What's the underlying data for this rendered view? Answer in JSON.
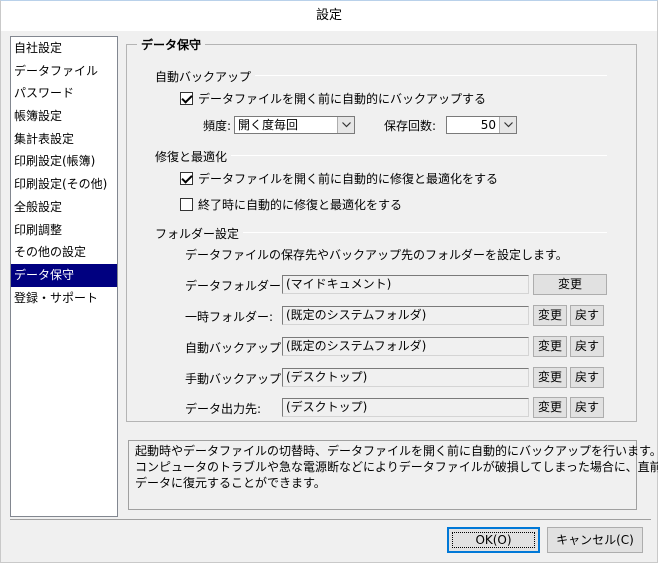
{
  "window": {
    "title": "設定"
  },
  "sidebar": {
    "items": [
      {
        "label": "自社設定"
      },
      {
        "label": "データファイル"
      },
      {
        "label": "パスワード"
      },
      {
        "label": "帳簿設定"
      },
      {
        "label": "集計表設定"
      },
      {
        "label": "印刷設定(帳簿)"
      },
      {
        "label": "印刷設定(その他)"
      },
      {
        "label": "全般設定"
      },
      {
        "label": "印刷調整"
      },
      {
        "label": "その他の設定"
      },
      {
        "label": "データ保守"
      },
      {
        "label": "登録・サポート"
      }
    ],
    "selected_index": 10
  },
  "panel": {
    "title": "データ保守",
    "auto_backup": {
      "section_title": "自動バックアップ",
      "checkbox_label": "データファイルを開く前に自動的にバックアップする",
      "checkbox_checked": true,
      "frequency_label": "頻度:",
      "frequency_value": "開く度毎回",
      "count_label": "保存回数:",
      "count_value": "50"
    },
    "repair": {
      "section_title": "修復と最適化",
      "check1_label": "データファイルを開く前に自動的に修復と最適化をする",
      "check1_checked": true,
      "check2_label": "終了時に自動的に修復と最適化をする",
      "check2_checked": false
    },
    "folders": {
      "section_title": "フォルダー設定",
      "description": "データファイルの保存先やバックアップ先のフォルダーを設定します。",
      "change_label": "変更",
      "reset_label": "戻す",
      "rows": [
        {
          "label": "データフォルダー:",
          "value": "(マイドキュメント)"
        },
        {
          "label": "一時フォルダー:",
          "value": "(既定のシステムフォルダ)"
        },
        {
          "label": "自動バックアップ:",
          "value": "(既定のシステムフォルダ)"
        },
        {
          "label": "手動バックアップ:",
          "value": "(デスクトップ)"
        },
        {
          "label": "データ出力先:",
          "value": "(デスクトップ)"
        }
      ]
    },
    "info": {
      "lines": [
        "起動時やデータファイルの切替時、データファイルを開く前に自動的にバックアップを行います。",
        "コンピュータのトラブルや急な電源断などによりデータファイルが破損してしまった場合に、直前の",
        "データに復元することができます。"
      ]
    }
  },
  "footer": {
    "ok_label": "OK(O)",
    "cancel_label": "キャンセル(C)"
  },
  "colors": {
    "selection": "#000080",
    "face": "#f0f0f0",
    "focus": "#0078d7"
  }
}
